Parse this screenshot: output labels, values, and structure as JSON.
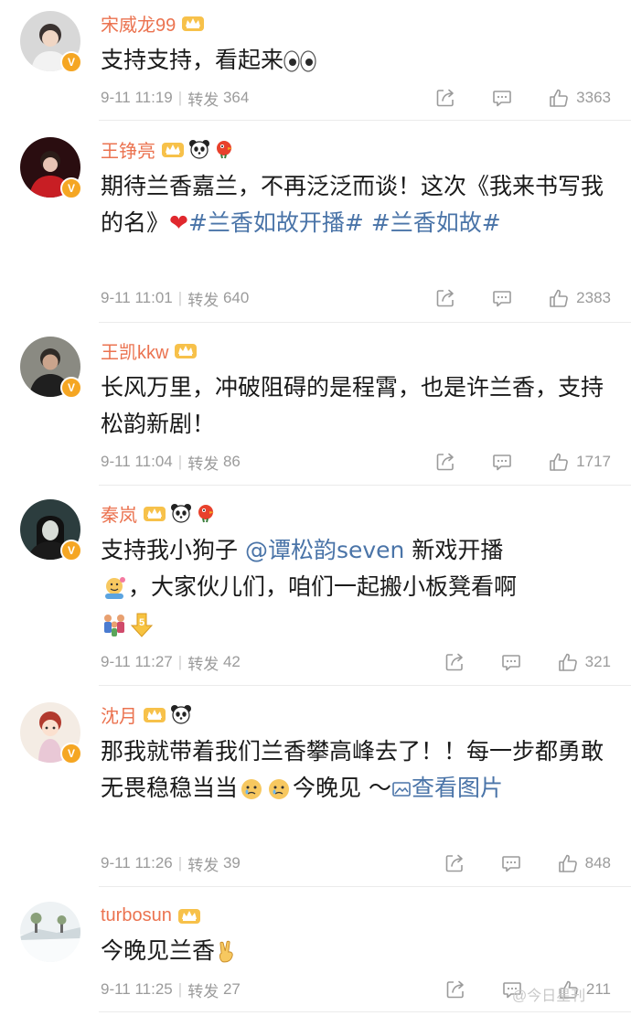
{
  "comments": [
    {
      "user": "宋威龙99",
      "text": "支持支持，看起来",
      "emoji": "eyes-emoji",
      "date": "9-11 11:19",
      "repost_label": "转发",
      "repost_count": "364",
      "likes": "3363"
    },
    {
      "user": "王铮亮",
      "text_a": "期待兰香嘉兰，不再泛泛而谈！这次《我来书写我的名》",
      "topic1": "#兰香如故开播#",
      "topic2": "#兰香如故#",
      "date": "9-11 11:01",
      "repost_label": "转发",
      "repost_count": "640",
      "likes": "2383"
    },
    {
      "user": "王凯kkw",
      "text": "长风万里，冲破阻碍的是程霄，也是许兰香，支持松韵新剧！",
      "date": "9-11 11:04",
      "repost_label": "转发",
      "repost_count": "86",
      "likes": "1717"
    },
    {
      "user": "秦岚",
      "text_a": "支持我小狗子",
      "mention": "@谭松韵seven",
      "text_b": "新戏开播",
      "text_c": "，大家伙儿们，咱们一起搬小板凳看啊",
      "date": "9-11 11:27",
      "repost_label": "转发",
      "repost_count": "42",
      "likes": "321"
    },
    {
      "user": "沈月",
      "text_a": "那我就带着我们兰香攀高峰去了！！每一步都勇敢无畏稳稳当当",
      "text_b": "今晚见 ～",
      "link_text": "查看图片",
      "date": "9-11 11:26",
      "repost_label": "转发",
      "repost_count": "39",
      "likes": "848"
    },
    {
      "user": "turbosun",
      "text": "今晚见兰香",
      "date": "9-11 11:25",
      "repost_label": "转发",
      "repost_count": "27",
      "likes": "211"
    }
  ],
  "watermark": "@今日星刊",
  "colors": {
    "username": "#eb7350",
    "topic": "#4a74a8",
    "meta": "#9b9b9b",
    "verified_badge": "#f5a623"
  }
}
